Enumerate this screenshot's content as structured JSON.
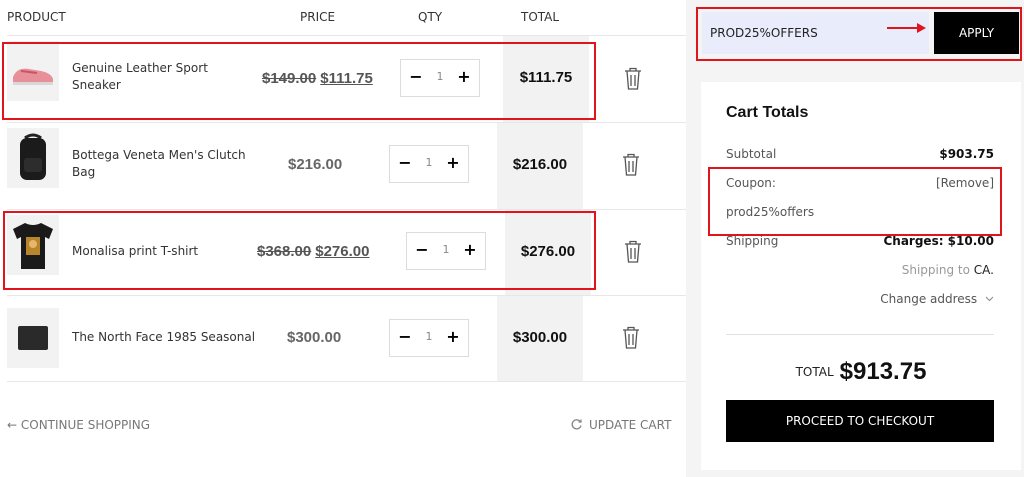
{
  "table_header": {
    "product": "PRODUCT",
    "price": "PRICE",
    "qty": "QTY",
    "total": "TOTAL"
  },
  "items": [
    {
      "name": "Genuine Leather Sport Sneaker",
      "old_price": "$149.00",
      "price": "$111.75",
      "qty": "1",
      "total": "$111.75",
      "image": "sneaker"
    },
    {
      "name": "Bottega Veneta Men's Clutch Bag",
      "price": "$216.00",
      "qty": "1",
      "total": "$216.00",
      "image": "backpack"
    },
    {
      "name": "Monalisa print T-shirt",
      "old_price": "$368.00",
      "price": "$276.00",
      "qty": "1",
      "total": "$276.00",
      "image": "tshirt"
    },
    {
      "name": "The North Face 1985 Seasonal",
      "price": "$300.00",
      "qty": "1",
      "total": "$300.00",
      "image": "wallet"
    }
  ],
  "qty_controls": {
    "minus": "−",
    "plus": "+"
  },
  "footer": {
    "continue": "← CONTINUE SHOPPING",
    "update": "UPDATE CART"
  },
  "coupon": {
    "code": "PROD25%OFFERS",
    "apply_label": "APPLY"
  },
  "cart_totals": {
    "title": "Cart Totals",
    "subtotal_label": "Subtotal",
    "subtotal_value": "$903.75",
    "coupon_label": "Coupon:",
    "coupon_remove": "[Remove]",
    "coupon_code": "prod25%offers",
    "shipping_label": "Shipping",
    "shipping_charges": "Charges: $10.00",
    "shipping_to_prefix": "Shipping to",
    "shipping_to_country": "CA.",
    "change_address": "Change address",
    "total_label": "TOTAL",
    "total_value": "$913.75",
    "checkout_label": "PROCEED TO CHECKOUT"
  },
  "colors": {
    "highlight": "#e0141a",
    "coupon_bg": "#e9ecfb",
    "button_bg": "#000000"
  }
}
